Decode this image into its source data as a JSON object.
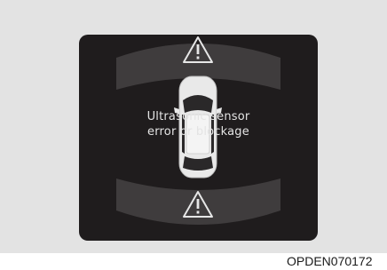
{
  "display": {
    "message_line1": "Ultrasonic sensor",
    "message_line2": "error or blockage",
    "front_icon": "warning-triangle-icon",
    "rear_icon": "warning-triangle-icon",
    "vehicle_icon": "car-top-view-icon"
  },
  "figure_code": "OPDEN070172",
  "colors": {
    "panel_background": "#e3e3e3",
    "screen_background": "#1f1c1d",
    "sensor_zone": "#3f3c3d",
    "text": "#e4e4e4"
  }
}
